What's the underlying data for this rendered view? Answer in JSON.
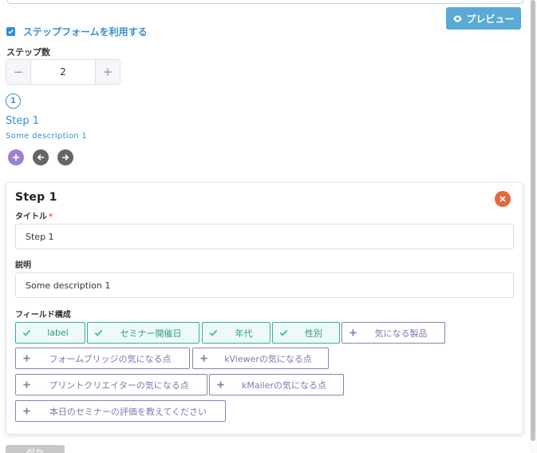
{
  "preview_button": {
    "label": "プレビュー",
    "icon": "eye-icon"
  },
  "use_step_form": {
    "label": "ステップフォームを利用する",
    "checked": true
  },
  "step_count": {
    "label": "ステップ数",
    "value": "2",
    "minus": "−",
    "plus": "+"
  },
  "step_indicator": {
    "number": "1",
    "title": "Step 1",
    "description": "Some description 1"
  },
  "step_controls": [
    "plus-icon",
    "arrow-left-icon",
    "arrow-right-icon"
  ],
  "step_card": {
    "heading": "Step 1",
    "title_label": "タイトル",
    "required_mark": "*",
    "title_value": "Step 1",
    "description_label": "説明",
    "description_value": "Some description 1",
    "fields_label": "フィールド構成",
    "fields": [
      {
        "label": "label",
        "selected": true
      },
      {
        "label": "セミナー開催日",
        "selected": true
      },
      {
        "label": "年代",
        "selected": true
      },
      {
        "label": "性別",
        "selected": true
      },
      {
        "label": "気になる製品",
        "selected": false
      },
      {
        "label": "フォームブリッジの気になる点",
        "selected": false
      },
      {
        "label": "kViewerの気になる点",
        "selected": false
      },
      {
        "label": "プリントクリエイターの気になる点",
        "selected": false
      },
      {
        "label": "kMailerの気になる点",
        "selected": false
      },
      {
        "label": "本日のセミナーの評価を教えてください",
        "selected": false
      }
    ]
  },
  "bottom_button": {
    "label": "保存"
  },
  "colors": {
    "accent_blue": "#3a8fd0",
    "preview_blue": "#5aa9d6",
    "selected_green": "#2bb39a",
    "unselected_purple": "#8b7fb5",
    "close_orange": "#e5683a"
  }
}
